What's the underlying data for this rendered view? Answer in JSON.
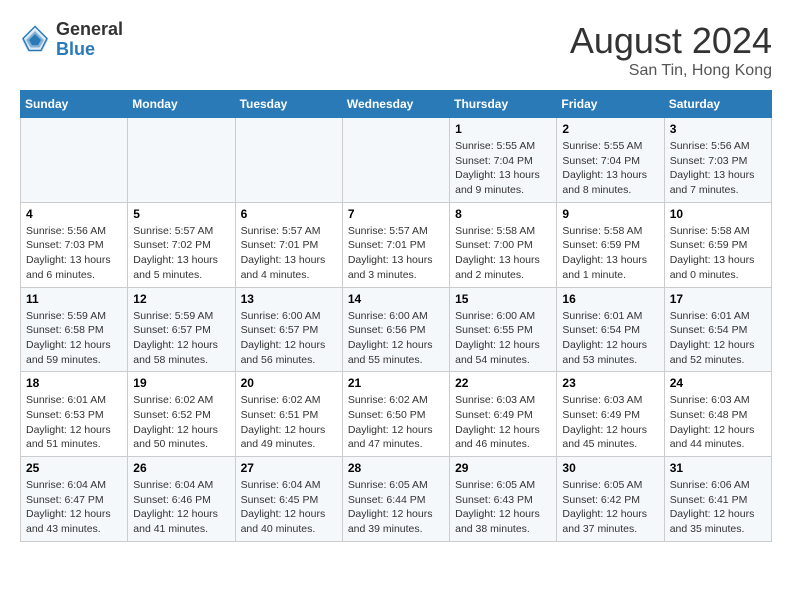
{
  "header": {
    "logo_general": "General",
    "logo_blue": "Blue",
    "month_year": "August 2024",
    "location": "San Tin, Hong Kong"
  },
  "days_of_week": [
    "Sunday",
    "Monday",
    "Tuesday",
    "Wednesday",
    "Thursday",
    "Friday",
    "Saturday"
  ],
  "weeks": [
    [
      {
        "day": "",
        "info": ""
      },
      {
        "day": "",
        "info": ""
      },
      {
        "day": "",
        "info": ""
      },
      {
        "day": "",
        "info": ""
      },
      {
        "day": "1",
        "info": "Sunrise: 5:55 AM\nSunset: 7:04 PM\nDaylight: 13 hours and 9 minutes."
      },
      {
        "day": "2",
        "info": "Sunrise: 5:55 AM\nSunset: 7:04 PM\nDaylight: 13 hours and 8 minutes."
      },
      {
        "day": "3",
        "info": "Sunrise: 5:56 AM\nSunset: 7:03 PM\nDaylight: 13 hours and 7 minutes."
      }
    ],
    [
      {
        "day": "4",
        "info": "Sunrise: 5:56 AM\nSunset: 7:03 PM\nDaylight: 13 hours and 6 minutes."
      },
      {
        "day": "5",
        "info": "Sunrise: 5:57 AM\nSunset: 7:02 PM\nDaylight: 13 hours and 5 minutes."
      },
      {
        "day": "6",
        "info": "Sunrise: 5:57 AM\nSunset: 7:01 PM\nDaylight: 13 hours and 4 minutes."
      },
      {
        "day": "7",
        "info": "Sunrise: 5:57 AM\nSunset: 7:01 PM\nDaylight: 13 hours and 3 minutes."
      },
      {
        "day": "8",
        "info": "Sunrise: 5:58 AM\nSunset: 7:00 PM\nDaylight: 13 hours and 2 minutes."
      },
      {
        "day": "9",
        "info": "Sunrise: 5:58 AM\nSunset: 6:59 PM\nDaylight: 13 hours and 1 minute."
      },
      {
        "day": "10",
        "info": "Sunrise: 5:58 AM\nSunset: 6:59 PM\nDaylight: 13 hours and 0 minutes."
      }
    ],
    [
      {
        "day": "11",
        "info": "Sunrise: 5:59 AM\nSunset: 6:58 PM\nDaylight: 12 hours and 59 minutes."
      },
      {
        "day": "12",
        "info": "Sunrise: 5:59 AM\nSunset: 6:57 PM\nDaylight: 12 hours and 58 minutes."
      },
      {
        "day": "13",
        "info": "Sunrise: 6:00 AM\nSunset: 6:57 PM\nDaylight: 12 hours and 56 minutes."
      },
      {
        "day": "14",
        "info": "Sunrise: 6:00 AM\nSunset: 6:56 PM\nDaylight: 12 hours and 55 minutes."
      },
      {
        "day": "15",
        "info": "Sunrise: 6:00 AM\nSunset: 6:55 PM\nDaylight: 12 hours and 54 minutes."
      },
      {
        "day": "16",
        "info": "Sunrise: 6:01 AM\nSunset: 6:54 PM\nDaylight: 12 hours and 53 minutes."
      },
      {
        "day": "17",
        "info": "Sunrise: 6:01 AM\nSunset: 6:54 PM\nDaylight: 12 hours and 52 minutes."
      }
    ],
    [
      {
        "day": "18",
        "info": "Sunrise: 6:01 AM\nSunset: 6:53 PM\nDaylight: 12 hours and 51 minutes."
      },
      {
        "day": "19",
        "info": "Sunrise: 6:02 AM\nSunset: 6:52 PM\nDaylight: 12 hours and 50 minutes."
      },
      {
        "day": "20",
        "info": "Sunrise: 6:02 AM\nSunset: 6:51 PM\nDaylight: 12 hours and 49 minutes."
      },
      {
        "day": "21",
        "info": "Sunrise: 6:02 AM\nSunset: 6:50 PM\nDaylight: 12 hours and 47 minutes."
      },
      {
        "day": "22",
        "info": "Sunrise: 6:03 AM\nSunset: 6:49 PM\nDaylight: 12 hours and 46 minutes."
      },
      {
        "day": "23",
        "info": "Sunrise: 6:03 AM\nSunset: 6:49 PM\nDaylight: 12 hours and 45 minutes."
      },
      {
        "day": "24",
        "info": "Sunrise: 6:03 AM\nSunset: 6:48 PM\nDaylight: 12 hours and 44 minutes."
      }
    ],
    [
      {
        "day": "25",
        "info": "Sunrise: 6:04 AM\nSunset: 6:47 PM\nDaylight: 12 hours and 43 minutes."
      },
      {
        "day": "26",
        "info": "Sunrise: 6:04 AM\nSunset: 6:46 PM\nDaylight: 12 hours and 41 minutes."
      },
      {
        "day": "27",
        "info": "Sunrise: 6:04 AM\nSunset: 6:45 PM\nDaylight: 12 hours and 40 minutes."
      },
      {
        "day": "28",
        "info": "Sunrise: 6:05 AM\nSunset: 6:44 PM\nDaylight: 12 hours and 39 minutes."
      },
      {
        "day": "29",
        "info": "Sunrise: 6:05 AM\nSunset: 6:43 PM\nDaylight: 12 hours and 38 minutes."
      },
      {
        "day": "30",
        "info": "Sunrise: 6:05 AM\nSunset: 6:42 PM\nDaylight: 12 hours and 37 minutes."
      },
      {
        "day": "31",
        "info": "Sunrise: 6:06 AM\nSunset: 6:41 PM\nDaylight: 12 hours and 35 minutes."
      }
    ]
  ]
}
